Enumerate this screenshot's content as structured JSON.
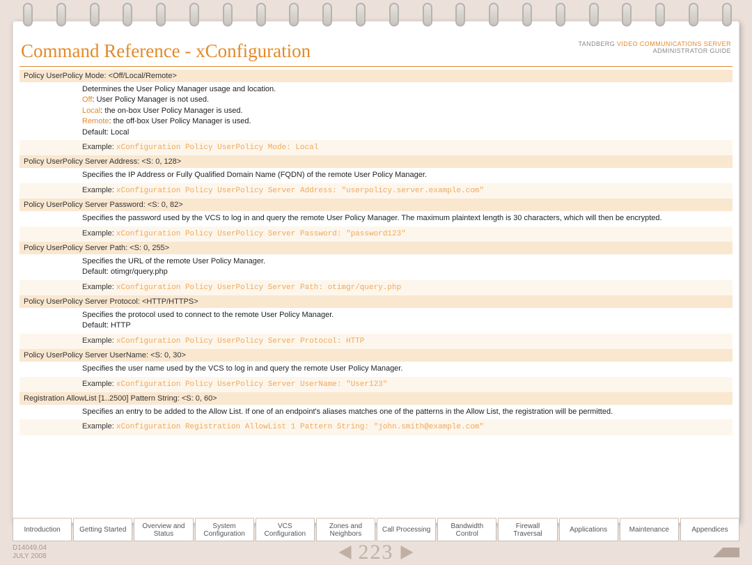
{
  "header": {
    "title": "Command Reference - xConfiguration",
    "brand_prefix": "TANDBERG ",
    "brand_product": "VIDEO COMMUNICATIONS SERVER",
    "brand_sub": "ADMINISTRATOR GUIDE"
  },
  "sections": [
    {
      "heading": "Policy UserPolicy Mode: <Off/Local/Remote>",
      "body": [
        {
          "text": "Determines the User Policy Manager usage and location."
        },
        {
          "keyword": "Off",
          "text": ": User Policy Manager is not used."
        },
        {
          "keyword": "Local",
          "text": ": the on-box User Policy Manager is used."
        },
        {
          "keyword": "Remote",
          "text": ": the off-box User Policy Manager is used."
        },
        {
          "text": "Default: Local"
        }
      ],
      "example": "xConfiguration Policy UserPolicy Mode: Local"
    },
    {
      "heading": "Policy UserPolicy Server Address: <S: 0, 128>",
      "body": [
        {
          "text": "Specifies the IP Address or Fully Qualified Domain Name (FQDN) of the remote User Policy Manager."
        }
      ],
      "example": "xConfiguration Policy UserPolicy Server Address: \"userpolicy.server.example.com\""
    },
    {
      "heading": "Policy UserPolicy Server Password: <S: 0, 82>",
      "body": [
        {
          "text": "Specifies the password used by the VCS to log in and query the remote User Policy Manager. The maximum plaintext length is 30 characters, which will then be encrypted."
        }
      ],
      "example": "xConfiguration Policy UserPolicy Server Password: \"password123\""
    },
    {
      "heading": "Policy UserPolicy Server Path: <S: 0, 255>",
      "body": [
        {
          "text": "Specifies the URL of the remote User Policy Manager."
        },
        {
          "text": "Default: otimgr/query.php"
        }
      ],
      "example": "xConfiguration Policy UserPolicy Server Path: otimgr/query.php"
    },
    {
      "heading": "Policy UserPolicy Server Protocol: <HTTP/HTTPS>",
      "body": [
        {
          "text": "Specifies the protocol used to connect to the remote User Policy Manager."
        },
        {
          "text": "Default: HTTP"
        }
      ],
      "example": "xConfiguration Policy UserPolicy Server Protocol: HTTP"
    },
    {
      "heading": "Policy UserPolicy Server UserName: <S: 0, 30>",
      "body": [
        {
          "text": "Specifies the user name used by the VCS to log in and query the remote User Policy Manager."
        }
      ],
      "example": "xConfiguration Policy UserPolicy Server UserName: \"User123\""
    },
    {
      "heading": "Registration AllowList [1..2500] Pattern String: <S: 0, 60>",
      "body": [
        {
          "text": "Specifies an entry to be added to the Allow List. If one of an endpoint's aliases matches one of the patterns in the Allow List, the registration will be permitted."
        }
      ],
      "example": "xConfiguration Registration AllowList 1 Pattern String: \"john.smith@example.com\""
    }
  ],
  "tabs": [
    "Introduction",
    "Getting Started",
    "Overview and Status",
    "System Configuration",
    "VCS Configuration",
    "Zones and Neighbors",
    "Call Processing",
    "Bandwidth Control",
    "Firewall Traversal",
    "Applications",
    "Maintenance",
    "Appendices"
  ],
  "footer": {
    "doc_id": "D14049.04",
    "doc_date": "JULY 2008",
    "page": "223"
  },
  "example_label": "Example: "
}
